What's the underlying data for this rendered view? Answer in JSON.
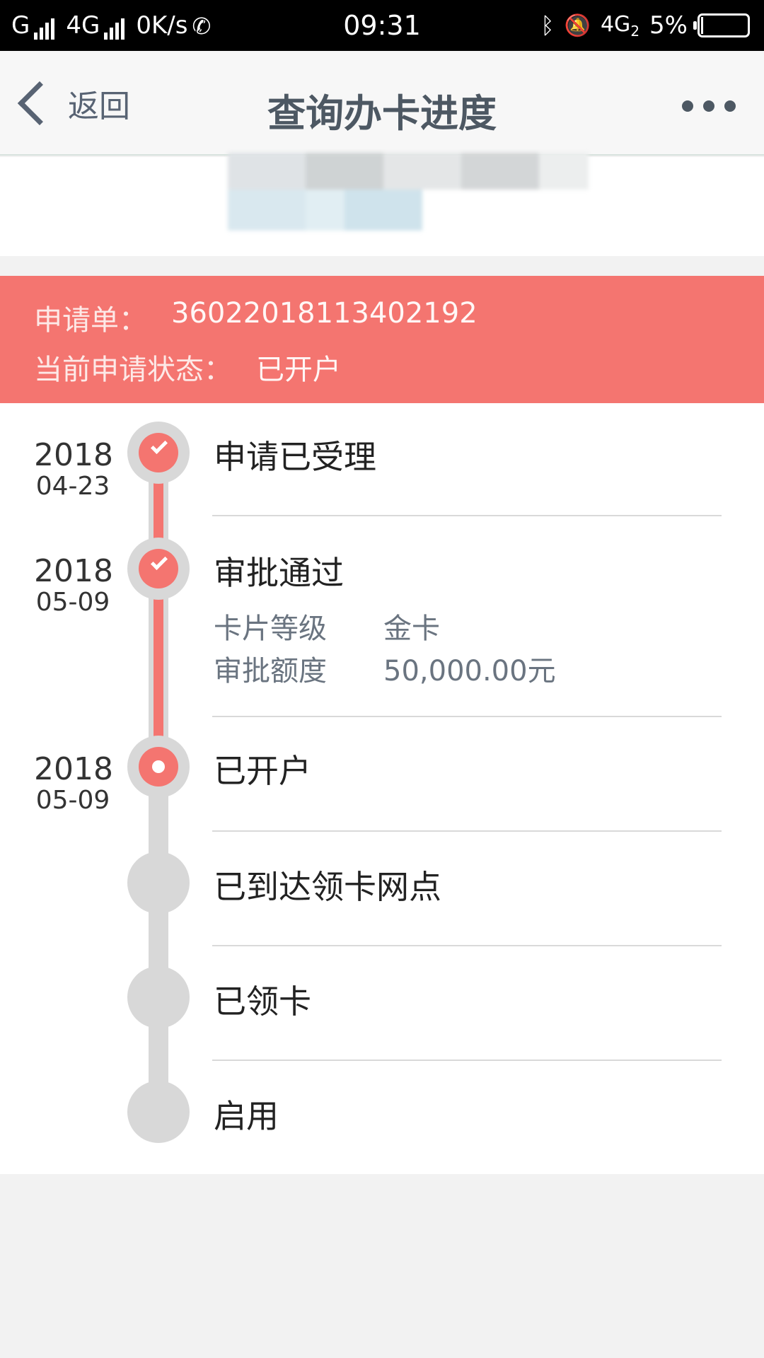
{
  "status_bar": {
    "carrier1": "G",
    "network2": "4G",
    "speed": "0K/s",
    "time": "09:31",
    "network_right": "4G",
    "network_right_sub": "2",
    "battery": "5%",
    "battery_level": 0.05
  },
  "nav": {
    "back_label": "返回",
    "title": "查询办卡进度"
  },
  "application": {
    "number_label": "申请单：",
    "number": "36022018113402192",
    "status_label": "当前申请状态：",
    "status": "已开户"
  },
  "timeline": {
    "steps": [
      {
        "year": "2018",
        "date": "04-23",
        "title": "申请已受理",
        "state": "done"
      },
      {
        "year": "2018",
        "date": "05-09",
        "title": "审批通过",
        "state": "done",
        "details": [
          {
            "label": "卡片等级",
            "value": "金卡"
          },
          {
            "label": "审批额度",
            "value": "50,000.00元"
          }
        ]
      },
      {
        "year": "2018",
        "date": "05-09",
        "title": "已开户",
        "state": "current"
      },
      {
        "title": "已到达领卡网点",
        "state": "pending"
      },
      {
        "title": "已领卡",
        "state": "pending"
      },
      {
        "title": "启用",
        "state": "pending"
      }
    ]
  },
  "colors": {
    "accent": "#f47570",
    "track": "#d8d8d8",
    "nav_text": "#4d5863"
  }
}
